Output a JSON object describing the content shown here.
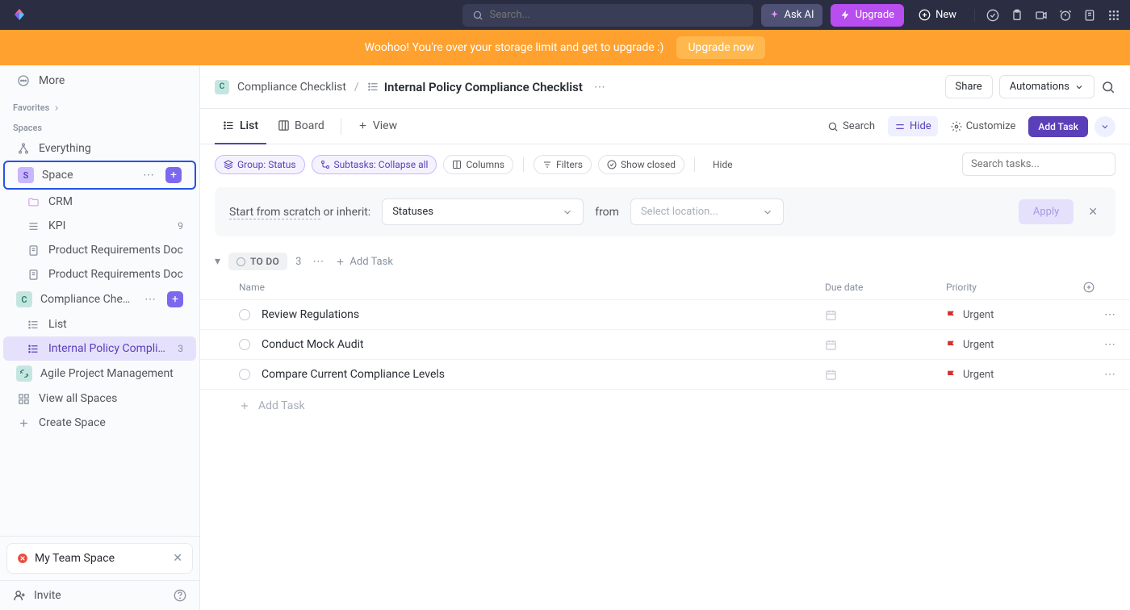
{
  "topbar": {
    "search_placeholder": "Search...",
    "ask_ai": "Ask AI",
    "upgrade": "Upgrade",
    "new": "New"
  },
  "banner": {
    "text": "Woohoo! You're over your storage limit and get to upgrade :)",
    "button": "Upgrade now"
  },
  "sidebar": {
    "more": "More",
    "favorites": "Favorites",
    "spaces": "Spaces",
    "everything": "Everything",
    "space": "Space",
    "items": [
      {
        "label": "CRM"
      },
      {
        "label": "KPI",
        "count": "9"
      },
      {
        "label": "Product Requirements Doc"
      },
      {
        "label": "Product Requirements Doc"
      }
    ],
    "compliance": "Compliance Checklist",
    "list": "List",
    "internal": "Internal Policy Compli…",
    "internal_count": "3",
    "agile": "Agile Project Management",
    "view_all": "View all Spaces",
    "create": "Create Space",
    "team_card": "My Team Space",
    "invite": "Invite"
  },
  "breadcrumb": {
    "parent": "Compliance Checklist",
    "title": "Internal Policy Compliance Checklist",
    "share": "Share",
    "automations": "Automations"
  },
  "views": {
    "list": "List",
    "board": "Board",
    "add": "View",
    "search": "Search",
    "hide": "Hide",
    "customize": "Customize",
    "add_task": "Add Task"
  },
  "filters": {
    "group": "Group: Status",
    "subtasks": "Subtasks: Collapse all",
    "columns": "Columns",
    "filters": "Filters",
    "show_closed": "Show closed",
    "hide": "Hide",
    "search_placeholder": "Search tasks..."
  },
  "inherit": {
    "scratch": "Start from scratch",
    "or_inherit": " or inherit:",
    "statuses": "Statuses",
    "from": "from",
    "location_placeholder": "Select location...",
    "apply": "Apply"
  },
  "group": {
    "status": "TO DO",
    "count": "3",
    "add_task": "Add Task"
  },
  "columns": {
    "name": "Name",
    "due": "Due date",
    "priority": "Priority"
  },
  "tasks": [
    {
      "name": "Review Regulations",
      "priority": "Urgent"
    },
    {
      "name": "Conduct Mock Audit",
      "priority": "Urgent"
    },
    {
      "name": "Compare Current Compliance Levels",
      "priority": "Urgent"
    }
  ],
  "add_task_row": "Add Task"
}
